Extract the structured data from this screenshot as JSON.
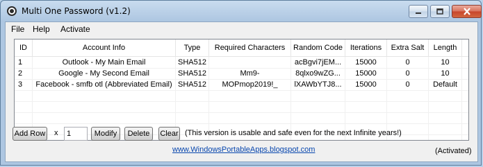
{
  "window": {
    "title": "Multi One Password (v1.2)"
  },
  "menu": [
    "File",
    "Help",
    "Activate"
  ],
  "table": {
    "headers": [
      "ID",
      "Account Info",
      "Type",
      "Required Characters",
      "Random Code",
      "Iterations",
      "Extra Salt",
      "Length"
    ],
    "rows": [
      [
        "1",
        "Outlook - My Main Email",
        "SHA512",
        "",
        "acBgvi7jEM...",
        "15000",
        "0",
        "10"
      ],
      [
        "2",
        "Google - My Second Email",
        "SHA512",
        "Mm9-",
        "8qlxo9wZG...",
        "15000",
        "0",
        "10"
      ],
      [
        "3",
        "Facebook - smfb otl (Abbreviated Email)",
        "SHA512",
        "MOPmop2019!_",
        "lXAWbYTJ8...",
        "15000",
        "0",
        "Default"
      ]
    ]
  },
  "controls": {
    "add_row": "Add Row",
    "times": "x",
    "count_value": "1",
    "modify": "Modify",
    "delete": "Delete",
    "clear": "Clear",
    "note": "(This version is usable and safe even for the next Infinite years!)"
  },
  "footer": {
    "link": "www.WindowsPortableApps.blogspot.com",
    "status": "(Activated)"
  }
}
